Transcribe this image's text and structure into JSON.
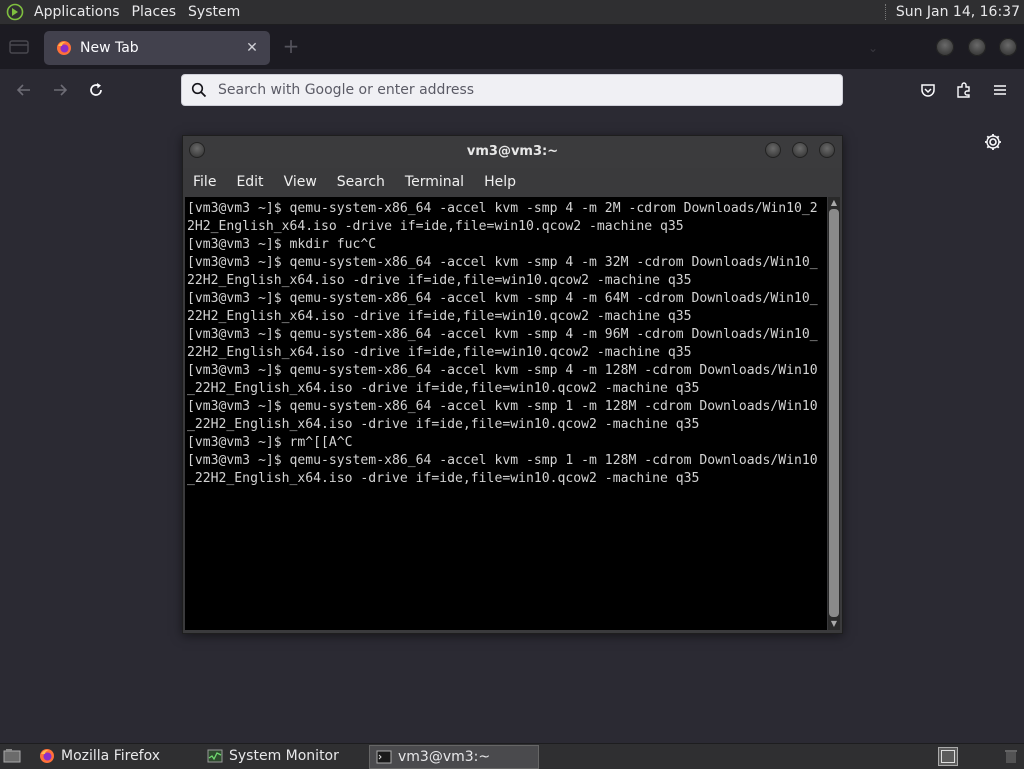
{
  "top_panel": {
    "menus": [
      "Applications",
      "Places",
      "System"
    ],
    "clock": "Sun Jan 14, 16:37"
  },
  "browser": {
    "tab_title": "New Tab",
    "urlbar_placeholder": "Search with Google or enter address"
  },
  "terminal": {
    "title": "vm3@vm3:~",
    "menu": [
      "File",
      "Edit",
      "View",
      "Search",
      "Terminal",
      "Help"
    ],
    "output": "[vm3@vm3 ~]$ qemu-system-x86_64 -accel kvm -smp 4 -m 2M -cdrom Downloads/Win10_2\n2H2_English_x64.iso -drive if=ide,file=win10.qcow2 -machine q35\n[vm3@vm3 ~]$ mkdir fuc^C\n[vm3@vm3 ~]$ qemu-system-x86_64 -accel kvm -smp 4 -m 32M -cdrom Downloads/Win10_\n22H2_English_x64.iso -drive if=ide,file=win10.qcow2 -machine q35\n[vm3@vm3 ~]$ qemu-system-x86_64 -accel kvm -smp 4 -m 64M -cdrom Downloads/Win10_\n22H2_English_x64.iso -drive if=ide,file=win10.qcow2 -machine q35\n[vm3@vm3 ~]$ qemu-system-x86_64 -accel kvm -smp 4 -m 96M -cdrom Downloads/Win10_\n22H2_English_x64.iso -drive if=ide,file=win10.qcow2 -machine q35\n[vm3@vm3 ~]$ qemu-system-x86_64 -accel kvm -smp 4 -m 128M -cdrom Downloads/Win10\n_22H2_English_x64.iso -drive if=ide,file=win10.qcow2 -machine q35\n[vm3@vm3 ~]$ qemu-system-x86_64 -accel kvm -smp 1 -m 128M -cdrom Downloads/Win10\n_22H2_English_x64.iso -drive if=ide,file=win10.qcow2 -machine q35\n[vm3@vm3 ~]$ rm^[[A^C\n[vm3@vm3 ~]$ qemu-system-x86_64 -accel kvm -smp 1 -m 128M -cdrom Downloads/Win10\n_22H2_English_x64.iso -drive if=ide,file=win10.qcow2 -machine q35"
  },
  "taskbar": {
    "items": [
      "Mozilla Firefox",
      "System Monitor",
      "vm3@vm3:~"
    ]
  },
  "colors": {
    "browser_bg": "#2b2a33",
    "panel_bg": "#2f2f31",
    "terminal_bg": "#000000",
    "terminal_fg": "#d3d3d3"
  },
  "icons": [
    "distro-logo-icon",
    "firefox-icon",
    "close-icon",
    "plus-icon",
    "back-icon",
    "forward-icon",
    "reload-icon",
    "search-icon",
    "pocket-icon",
    "extensions-icon",
    "hamburger-menu-icon",
    "gear-icon",
    "system-monitor-icon",
    "terminal-icon",
    "show-desktop-icon",
    "trash-icon"
  ]
}
